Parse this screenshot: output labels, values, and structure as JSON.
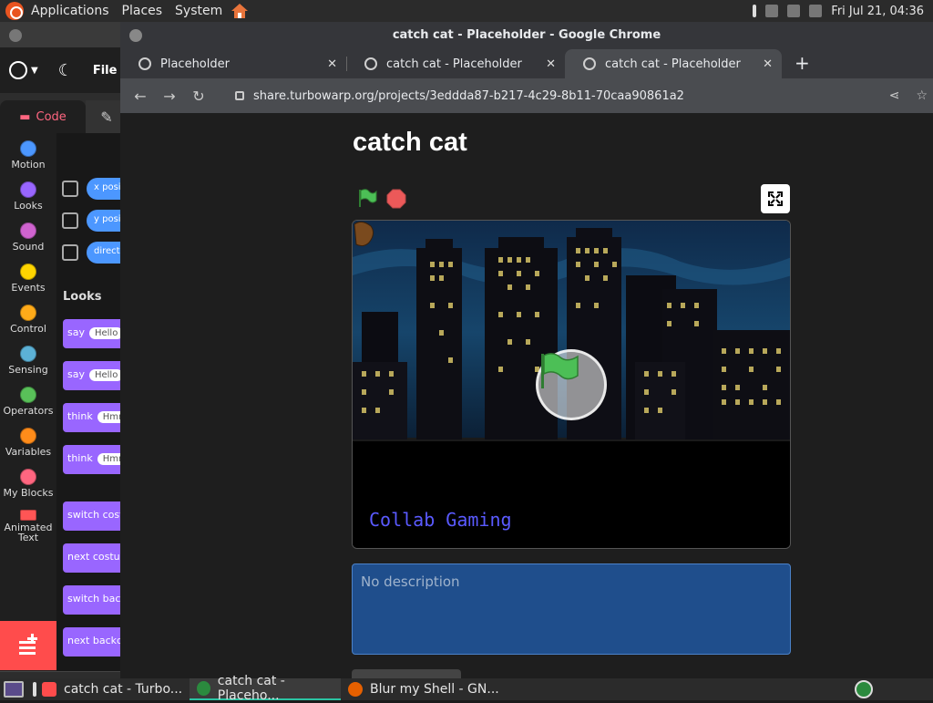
{
  "topbar": {
    "menu": [
      "Applications",
      "Places",
      "System"
    ],
    "datetime": "Fri Jul 21, 04:36"
  },
  "turbowarp": {
    "menu_file": "File",
    "tab_code": "Code",
    "categories": [
      "Motion",
      "Looks",
      "Sound",
      "Events",
      "Control",
      "Sensing",
      "Operators",
      "Variables",
      "My Blocks",
      "Animated\nText"
    ],
    "category_colors": [
      "#4c97ff",
      "#9966ff",
      "#cf63cf",
      "#ffd500",
      "#ffab19",
      "#5cb1d6",
      "#59c059",
      "#ff8c1a",
      "#ff6680",
      "#ff5555"
    ],
    "motion_reporters": [
      "x posi",
      "y posi",
      "directi"
    ],
    "palette_heading": "Looks",
    "looks_blocks": [
      {
        "label": "say",
        "input": "Hello"
      },
      {
        "label": "say",
        "input": "Hello"
      },
      {
        "label": "think",
        "input": "Hmm"
      },
      {
        "label": "think",
        "input": "Hmm"
      },
      {
        "label": "switch costu",
        "input": ""
      },
      {
        "label": "next costum",
        "input": ""
      },
      {
        "label": "switch backd",
        "input": ""
      },
      {
        "label": "next backdr",
        "input": ""
      }
    ]
  },
  "chrome": {
    "window_title": "catch cat - Placeholder - Google Chrome",
    "tabs": [
      {
        "label": "Placeholder",
        "active": false
      },
      {
        "label": "catch cat - Placeholder",
        "active": false
      },
      {
        "label": "catch cat - Placeholder",
        "active": true
      }
    ],
    "url": "share.turbowarp.org/projects/3eddda87-b217-4c29-8b11-70caa90861a2"
  },
  "project": {
    "title": "catch cat",
    "stage_caption": "Collab Gaming",
    "description_placeholder": "No description"
  },
  "taskbar": {
    "items": [
      "catch cat - Turbo...",
      "catch cat - Placeho...",
      "Blur my Shell - GN..."
    ]
  },
  "colors": {
    "accent_green": "#2ac3a2",
    "description_bg": "#1f4e8c",
    "code_tab_text": "#ff6680"
  }
}
